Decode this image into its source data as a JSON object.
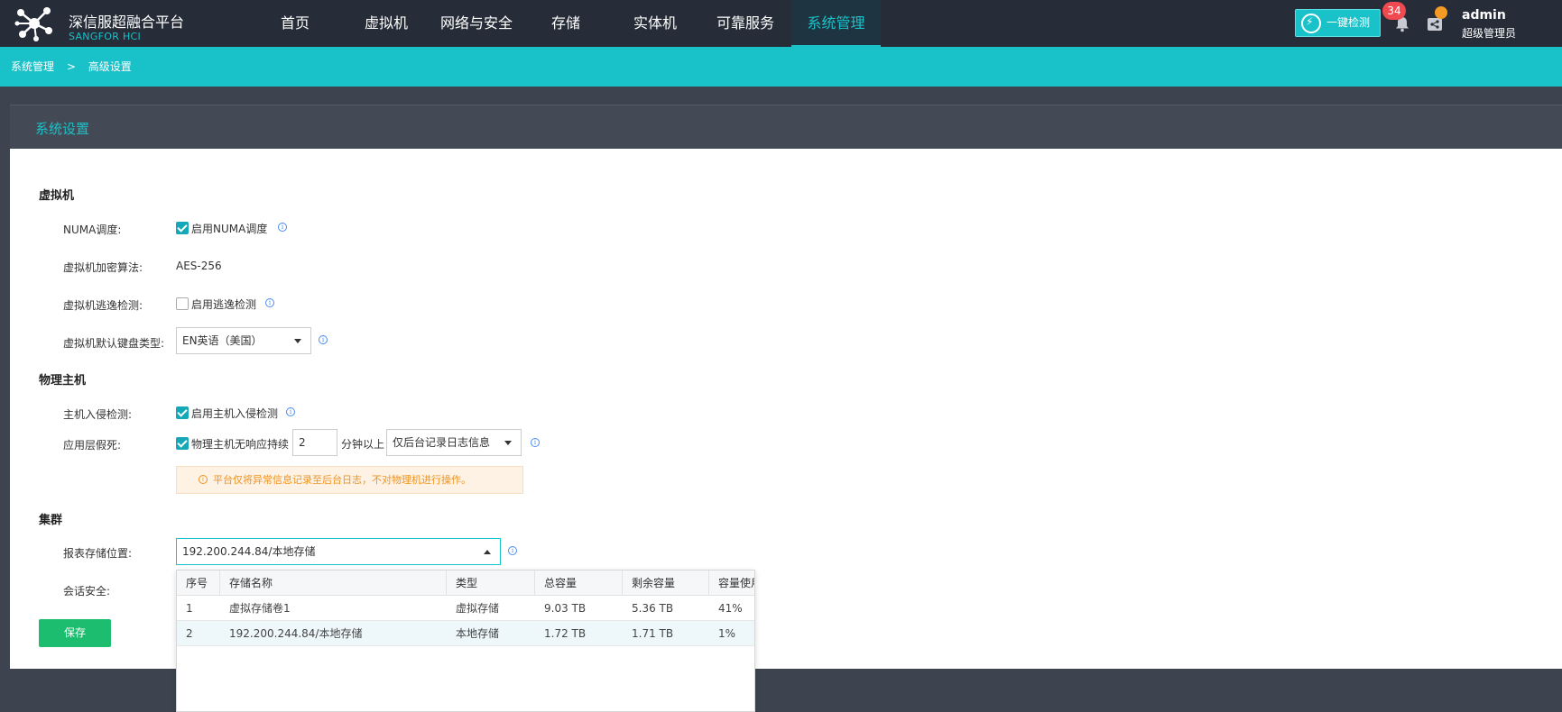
{
  "header": {
    "brand_cn": "深信服超融合平台",
    "brand_en": "SANGFOR HCI",
    "nav": [
      {
        "label": "首页"
      },
      {
        "label": "虚拟机"
      },
      {
        "label": "网络与安全"
      },
      {
        "label": "存储"
      },
      {
        "label": "实体机"
      },
      {
        "label": "可靠服务"
      },
      {
        "label": "系统管理",
        "active": true
      }
    ],
    "check_button": "一键检测",
    "notification_count": "34",
    "user_name": "admin",
    "user_role": "超级管理员",
    "accent_color": "#19c1c9"
  },
  "breadcrumb": {
    "root": "系统管理",
    "sep": ">",
    "current": "高级设置"
  },
  "panel": {
    "title": "系统设置"
  },
  "vm": {
    "section": "虚拟机",
    "numa_label": "NUMA调度:",
    "numa_checkbox": "启用NUMA调度",
    "numa_checked": true,
    "encrypt_label": "虚拟机加密算法:",
    "encrypt_value": "AES-256",
    "escape_label": "虚拟机逃逸检测:",
    "escape_checkbox": "启用逃逸检测",
    "escape_checked": false,
    "keyboard_label": "虚拟机默认键盘类型:",
    "keyboard_value": "EN英语（美国）"
  },
  "host": {
    "section": "物理主机",
    "intrusion_label": "主机入侵检测:",
    "intrusion_checkbox": "启用主机入侵检测",
    "intrusion_checked": true,
    "hang_label": "应用层假死:",
    "hang_checkbox": "物理主机无响应持续",
    "hang_checked": true,
    "hang_minutes": "2",
    "hang_unit": "分钟以上",
    "hang_action": "仅后台记录日志信息",
    "warning": "平台仅将异常信息记录至后台日志，不对物理机进行操作。"
  },
  "cluster": {
    "section": "集群",
    "report_label": "报表存储位置:",
    "report_value": "192.200.244.84/本地存储",
    "session_label": "会话安全:"
  },
  "storage_table": {
    "columns": [
      "序号",
      "存储名称",
      "类型",
      "总容量",
      "剩余容量",
      "容量使用率"
    ],
    "rows": [
      [
        "1",
        "虚拟存储卷1",
        "虚拟存储",
        "9.03 TB",
        "5.36 TB",
        "41%"
      ],
      [
        "2",
        "192.200.244.84/本地存储",
        "本地存储",
        "1.72 TB",
        "1.71 TB",
        "1%"
      ]
    ],
    "selected_row": 2
  },
  "save_button": "保存"
}
